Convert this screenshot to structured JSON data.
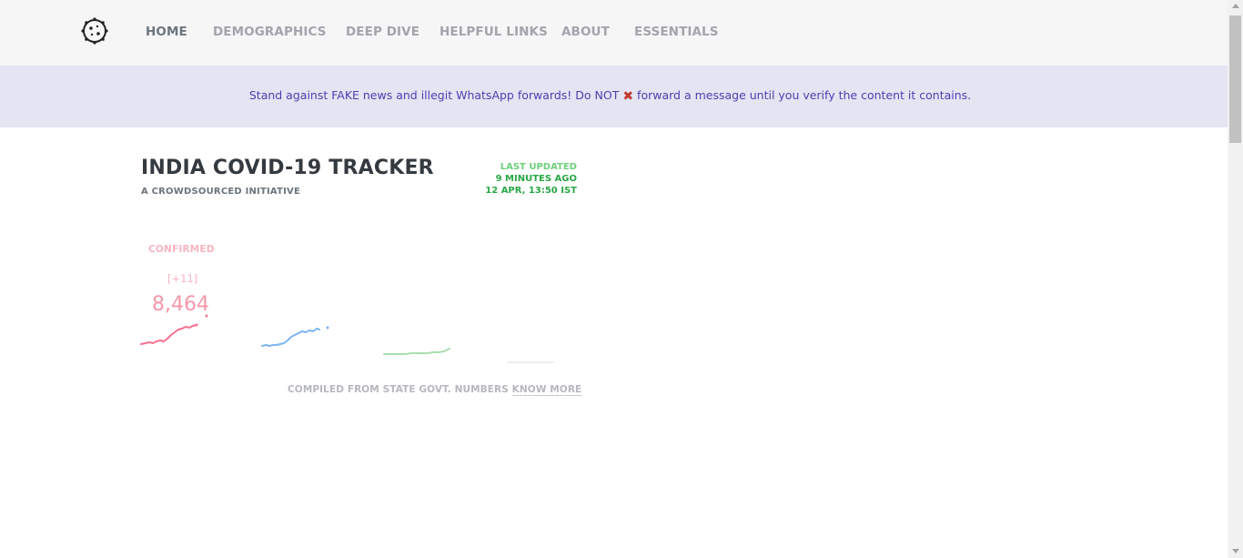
{
  "nav": {
    "logo_icon": "virus-icon",
    "items": [
      {
        "label": "HOME",
        "active": true
      },
      {
        "label": "DEMOGRAPHICS",
        "active": false
      },
      {
        "label": "DEEP DIVE",
        "active": false
      },
      {
        "label": "HELPFUL LINKS",
        "active": false
      },
      {
        "label": "ABOUT",
        "active": false
      },
      {
        "label": "ESSENTIALS",
        "active": false
      }
    ]
  },
  "banner": {
    "text_before": "Stand against FAKE news and illegit WhatsApp forwards! Do NOT",
    "icon": "cross-mark-icon",
    "text_after": "forward a message until you verify the content it contains."
  },
  "header": {
    "title": "INDIA COVID-19 TRACKER",
    "subtitle": "A CROWDSOURCED INITIATIVE",
    "last_updated_label": "LAST UPDATED",
    "last_updated_relative": "9 MINUTES AGO",
    "last_updated_time": "12 APR, 13:50 IST"
  },
  "stats": {
    "confirmed": {
      "label": "CONFIRMED",
      "delta": "[+11]",
      "value": "8,464"
    }
  },
  "colors": {
    "confirmed": "#f8728f",
    "active": "#7eb5f5",
    "recovered": "#a9dfae",
    "deceased": "#e5e5e5",
    "banner_bg": "#e4e4f2",
    "banner_text": "#4c3fb0"
  },
  "footer": {
    "compiled_text": "COMPILED FROM STATE GOVT. NUMBERS",
    "know_more": "KNOW MORE"
  }
}
